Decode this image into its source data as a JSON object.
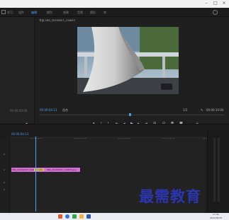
{
  "nav": {
    "items": [
      {
        "label": "学习",
        "active": false
      },
      {
        "label": "组件",
        "active": false
      },
      {
        "label": "编辑",
        "active": true
      },
      {
        "label": "颜色",
        "active": false
      },
      {
        "label": "效果",
        "active": false
      },
      {
        "label": "音频",
        "active": false
      },
      {
        "label": "图形",
        "active": false
      },
      {
        "label": "库",
        "active": false
      }
    ]
  },
  "source": {
    "timecode": "00:00:00:00"
  },
  "program": {
    "title": "节目: IMG_20190507_134633",
    "timecode": "00:00:04:13",
    "fit": "适合",
    "ratio": "1/2",
    "duration": "00:00:10:00"
  },
  "timeline": {
    "timecode": "00:00:04:13",
    "ruler": [
      "00:00:00:00",
      "00:00:05:00",
      "00:00:10:00",
      "00:00:15:00",
      "00:00:20:00"
    ],
    "clip_left": "IMG_20190507_134633.jpg",
    "clip_transition": "交叉叠化",
    "clip_right": "IMG_20190507_134633.jpg"
  },
  "taskbar": {
    "time": "17:04",
    "date": "2021/05/15"
  },
  "watermark": "最需教育",
  "colors": {
    "accent": "#4a9ae8",
    "clip": "#d36ed3",
    "watermark": "#2c35b0"
  }
}
